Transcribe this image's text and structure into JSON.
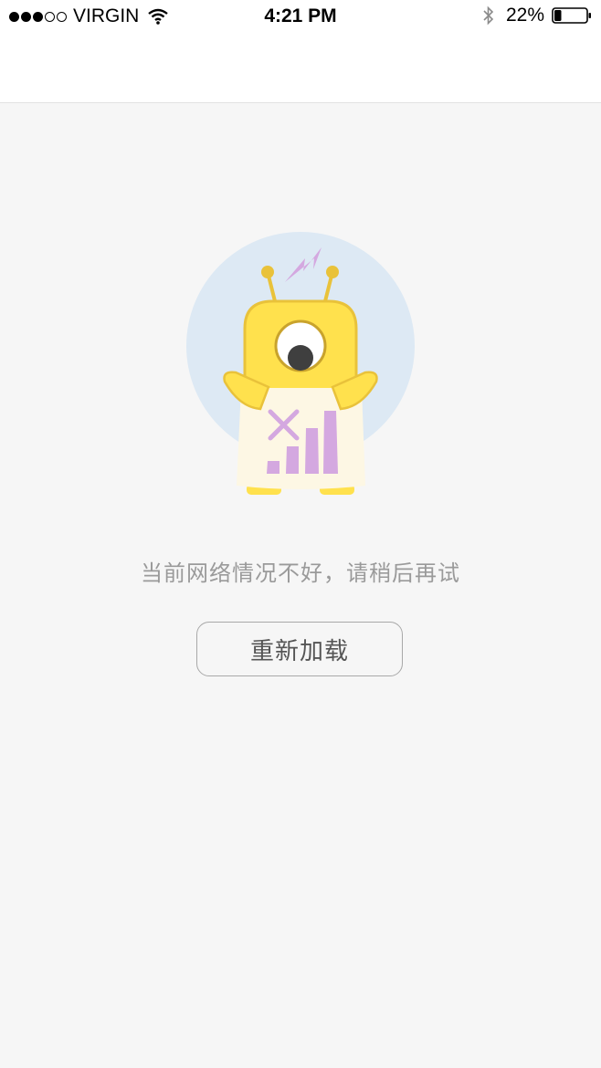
{
  "status_bar": {
    "carrier": "VIRGIN",
    "time": "4:21 PM",
    "battery_percent": "22%",
    "battery_level": 0.22,
    "signal_bars_filled": 3,
    "signal_bars_total": 5
  },
  "empty_state": {
    "message": "当前网络情况不好，请稍后再试",
    "reload_label": "重新加载"
  },
  "colors": {
    "background": "#f6f6f6",
    "illustration_circle": "#dde9f4",
    "robot_yellow": "#ffe14d",
    "robot_outline": "#e9c23a",
    "sign_paper": "#fdf7e4",
    "signal_purple": "#d4a8e0"
  },
  "icons": [
    "wifi-icon",
    "bluetooth-icon",
    "battery-icon",
    "lightning-icon"
  ]
}
